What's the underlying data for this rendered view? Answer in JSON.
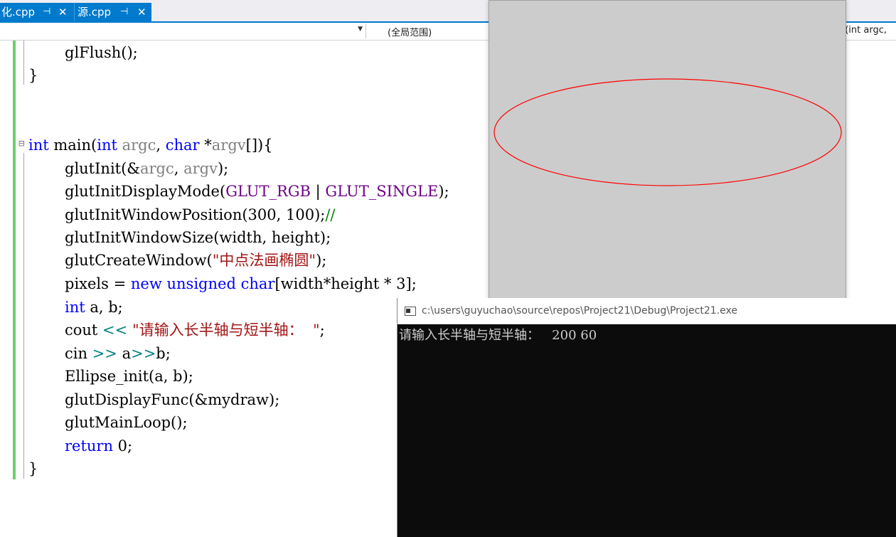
{
  "tabs": [
    {
      "name": "化.cpp",
      "pin": "⊣",
      "close": "✕"
    },
    {
      "name": "源.cpp",
      "pin": "⊣",
      "close": "✕"
    }
  ],
  "nav": {
    "scope": "(全局范围)",
    "function": "n(int argc,",
    "arrow": "▼"
  },
  "code": {
    "line1": {
      "text": "glFlush();"
    },
    "line2": {
      "text": "}"
    },
    "main_sig": {
      "kw1": "int",
      "name": " main(",
      "kw2": "int",
      "p1": " argc",
      "sep": ", ",
      "kw3": "char",
      "star": " *",
      "p2": "argv",
      "rest": "[]){"
    },
    "l_init": {
      "fn": "glutInit(&",
      "p1": "argc",
      "sep": ", ",
      "p2": "argv",
      "end": ");"
    },
    "l_mode": {
      "fn": "glutInitDisplayMode(",
      "m1": "GLUT_RGB",
      "op": " | ",
      "m2": "GLUT_SINGLE",
      "end": ");"
    },
    "l_pos": {
      "fn": "glutInitWindowPosition(300, 100);",
      "cmt": "//"
    },
    "l_size": {
      "text": "glutInitWindowSize(width, height);"
    },
    "l_create": {
      "fn": "glutCreateWindow(",
      "str": "\"中点法画椭圆\"",
      "end": ");"
    },
    "l_pixels": {
      "a": "pixels = ",
      "kw1": "new",
      "sp1": " ",
      "kw2": "unsigned",
      "sp2": " ",
      "kw3": "char",
      "rest": "[width*height * 3];"
    },
    "l_int": {
      "kw": "int",
      "rest": " a, b;"
    },
    "l_cout": {
      "a": "cout ",
      "op": "<<",
      "sp": " ",
      "str": "\"请输入长半轴与短半轴：  \"",
      "end": ";"
    },
    "l_cin": {
      "a": "cin ",
      "op1": ">>",
      "b": " a",
      "op2": ">>",
      "c": "b;"
    },
    "l_ell": {
      "text": "Ellipse_init(a, b);"
    },
    "l_disp": {
      "text": "glutDisplayFunc(&mydraw);"
    },
    "l_loop": {
      "text": "glutMainLoop();"
    },
    "l_ret": {
      "kw": "return",
      "rest": " 0;"
    },
    "l_close": {
      "text": "}"
    }
  },
  "fold_marker": "⊟",
  "colors": {
    "keyword": "#0000ff",
    "string": "#a31515",
    "macro": "#6f008a",
    "ellipse": "#ff0000",
    "gl_bg": "#cccccc",
    "console_bg": "#0c0c0c"
  },
  "console": {
    "path": "c:\\users\\guyuchao\\source\\repos\\Project21\\Debug\\Project21.exe",
    "output": "请输入长半轴与短半轴：   200 60"
  }
}
